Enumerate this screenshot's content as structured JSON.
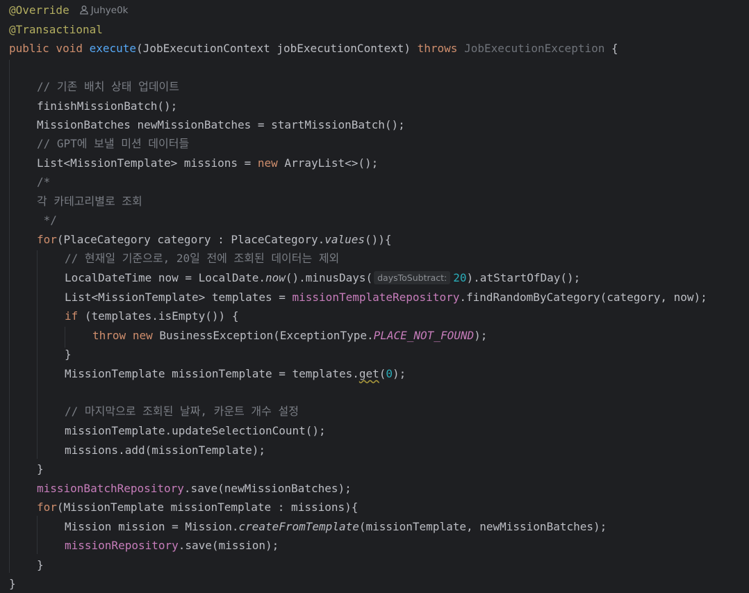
{
  "annotations": {
    "override": "@Override",
    "transactional": "@Transactional"
  },
  "author": "Juhye0k",
  "method": {
    "kw_public": "public",
    "kw_void": "void",
    "name": "execute",
    "params": "(JobExecutionContext jobExecutionContext) ",
    "kw_throws": "throws",
    "exception": "JobExecutionException",
    "open_brace": " {"
  },
  "code": {
    "c1": "// 기존 배치 상태 업데이트",
    "l_finish": "finishMissionBatch();",
    "l_start": "MissionBatches newMissionBatches = startMissionBatch();",
    "c2": "// GPT에 보낼 미션 데이터들",
    "l_list_a": "List<MissionTemplate> missions = ",
    "kw_new": "new",
    "l_list_b": " ArrayList<>();",
    "bc_open": "/*",
    "bc_text": "각 카테고리별로 조회",
    "bc_close": " */",
    "kw_for": "for",
    "for1_a": "(PlaceCategory category : PlaceCategory.",
    "for1_values": "values",
    "for1_b": "()){",
    "c3": "// 현재일 기준으로, 20일 전에 조회된 데이터는 제외",
    "now_a": "LocalDateTime now = LocalDate.",
    "now_fn": "now",
    "now_b": "().minusDays(",
    "now_hint": "daysToSubtract:",
    "now_num": "20",
    "now_c": ").atStartOfDay();",
    "tpl_a": "List<MissionTemplate> templates = ",
    "tpl_repo": "missionTemplateRepository",
    "tpl_b": ".findRandomByCategory(category, now);",
    "kw_if": "if",
    "if_b": " (templates.isEmpty()) {",
    "kw_throw": "throw",
    "throw_sp": " ",
    "throw_b": " BusinessException(ExceptionType.",
    "throw_const": "PLACE_NOT_FOUND",
    "throw_c": ");",
    "close_if": "}",
    "mt_a": "MissionTemplate missionTemplate = templates.",
    "mt_get": "get",
    "mt_b": "(",
    "mt_num": "0",
    "mt_c": ");",
    "c4": "// 마지막으로 조회된 날짜, 카운트 개수 설정",
    "upd": "missionTemplate.updateSelectionCount();",
    "add": "missions.add(missionTemplate);",
    "close_for1": "}",
    "save_repo": "missionBatchRepository",
    "save_b": ".save(newMissionBatches);",
    "for2_b": "(MissionTemplate missionTemplate : missions){",
    "mis_a": "Mission mission = Mission.",
    "mis_fn": "createFromTemplate",
    "mis_b": "(missionTemplate, newMissionBatches);",
    "mrepo": "missionRepository",
    "mrepo_b": ".save(mission);",
    "close_for2": "}",
    "close_method": "}"
  },
  "colors": {
    "background": "#1e1f22",
    "keyword": "#cf8e6d",
    "annotation": "#b3ae60",
    "function": "#56a8f5",
    "comment": "#7a7e85",
    "field": "#c77dbb",
    "number": "#2aacb8"
  }
}
